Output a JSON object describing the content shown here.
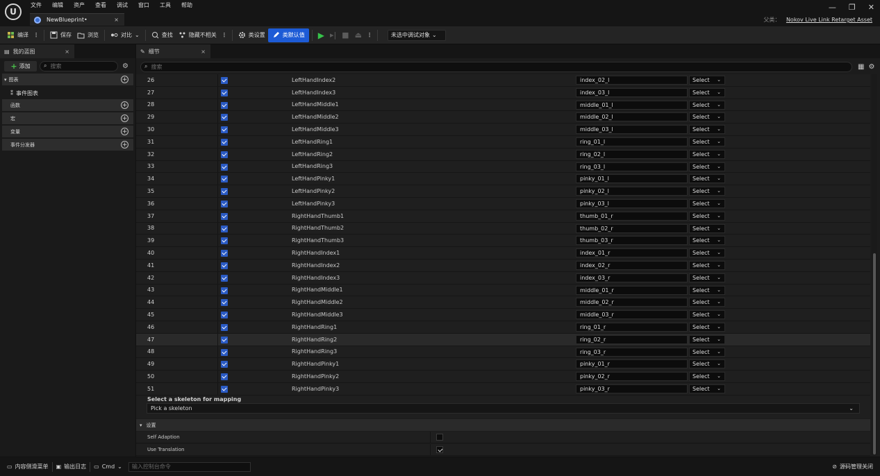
{
  "menu": [
    "文件",
    "编辑",
    "资产",
    "查看",
    "调试",
    "窗口",
    "工具",
    "帮助"
  ],
  "document_tab": {
    "label": "NewBlueprint•",
    "close": "×"
  },
  "window_controls": {
    "minimize": "—",
    "restore": "❐",
    "close": "✕"
  },
  "parent_class": {
    "label": "父类：",
    "value": "Nokov Live Link Retarget Asset"
  },
  "toolbar": {
    "compile": "编译",
    "save": "保存",
    "browse": "浏览",
    "diff": "对比",
    "find": "查找",
    "hide_unrelated": "隐藏不相关",
    "class_settings": "类设置",
    "class_defaults": "类默认值",
    "debug_target": "未选中调试对象"
  },
  "left_panel": {
    "tab": "我的蓝图",
    "add": "添加",
    "search_placeholder": "搜索",
    "graphs": "图表",
    "event_graph": "事件图表",
    "functions": "函数",
    "macros": "宏",
    "variables": "变量",
    "event_dispatchers": "事件分发器"
  },
  "details": {
    "tab": "细节",
    "search_placeholder": "搜索",
    "select_label": "Select",
    "rows": [
      {
        "index": "26",
        "bone": "LeftHandIndex2",
        "target": "index_02_l"
      },
      {
        "index": "27",
        "bone": "LeftHandIndex3",
        "target": "index_03_l"
      },
      {
        "index": "28",
        "bone": "LeftHandMiddle1",
        "target": "middle_01_l"
      },
      {
        "index": "29",
        "bone": "LeftHandMiddle2",
        "target": "middle_02_l"
      },
      {
        "index": "30",
        "bone": "LeftHandMiddle3",
        "target": "middle_03_l"
      },
      {
        "index": "31",
        "bone": "LeftHandRing1",
        "target": "ring_01_l"
      },
      {
        "index": "32",
        "bone": "LeftHandRing2",
        "target": "ring_02_l"
      },
      {
        "index": "33",
        "bone": "LeftHandRing3",
        "target": "ring_03_l"
      },
      {
        "index": "34",
        "bone": "LeftHandPinky1",
        "target": "pinky_01_l"
      },
      {
        "index": "35",
        "bone": "LeftHandPinky2",
        "target": "pinky_02_l"
      },
      {
        "index": "36",
        "bone": "LeftHandPinky3",
        "target": "pinky_03_l"
      },
      {
        "index": "37",
        "bone": "RightHandThumb1",
        "target": "thumb_01_r"
      },
      {
        "index": "38",
        "bone": "RightHandThumb2",
        "target": "thumb_02_r"
      },
      {
        "index": "39",
        "bone": "RightHandThumb3",
        "target": "thumb_03_r"
      },
      {
        "index": "40",
        "bone": "RightHandIndex1",
        "target": "index_01_r"
      },
      {
        "index": "41",
        "bone": "RightHandIndex2",
        "target": "index_02_r"
      },
      {
        "index": "42",
        "bone": "RightHandIndex3",
        "target": "index_03_r"
      },
      {
        "index": "43",
        "bone": "RightHandMiddle1",
        "target": "middle_01_r"
      },
      {
        "index": "44",
        "bone": "RightHandMiddle2",
        "target": "middle_02_r"
      },
      {
        "index": "45",
        "bone": "RightHandMiddle3",
        "target": "middle_03_r"
      },
      {
        "index": "46",
        "bone": "RightHandRing1",
        "target": "ring_01_r"
      },
      {
        "index": "47",
        "bone": "RightHandRing2",
        "target": "ring_02_r"
      },
      {
        "index": "48",
        "bone": "RightHandRing3",
        "target": "ring_03_r"
      },
      {
        "index": "49",
        "bone": "RightHandPinky1",
        "target": "pinky_01_r"
      },
      {
        "index": "50",
        "bone": "RightHandPinky2",
        "target": "pinky_02_r"
      },
      {
        "index": "51",
        "bone": "RightHandPinky3",
        "target": "pinky_03_r"
      }
    ],
    "skeleton_title": "Select a skeleton for mapping",
    "skeleton_value": "Pick a skeleton",
    "settings_header": "设置",
    "self_adaption": "Self Adaption",
    "use_translation": "Use Translation"
  },
  "statusbar": {
    "content_drawer": "内容侧滑菜单",
    "output_log": "输出日志",
    "cmd": "Cmd",
    "console_placeholder": "输入控制台命令",
    "source_control": "源码管理关闭"
  },
  "colors": {
    "accent": "#1d5bd6",
    "check": "#2b5bc4",
    "play": "#36c24a"
  }
}
